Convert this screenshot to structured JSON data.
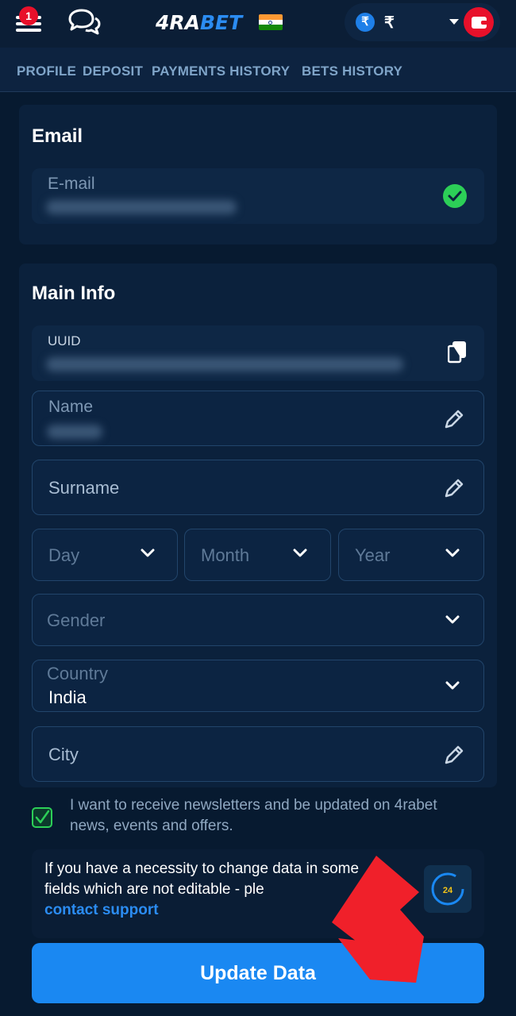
{
  "header": {
    "notifications_count": "1",
    "logo_part1": "4RA",
    "logo_part2": "BET",
    "currency_symbol": "₹",
    "balance_currency": "₹",
    "flag_colors": [
      "#ff9933",
      "#ffffff",
      "#138808"
    ]
  },
  "nav_tabs": [
    "PROFILE",
    "DEPOSIT",
    "PAYMENTS HISTORY",
    "BETS HISTORY"
  ],
  "email_section": {
    "title": "Email",
    "email_label": "E-mail",
    "verified_icon": "check-circle-icon"
  },
  "main_info": {
    "title": "Main Info",
    "uuid_label": "UUID",
    "name_label": "Name",
    "surname_placeholder": "Surname",
    "day_placeholder": "Day",
    "month_placeholder": "Month",
    "year_placeholder": "Year",
    "gender_placeholder": "Gender",
    "country_label": "Country",
    "country_value": "India",
    "city_placeholder": "City"
  },
  "newsletter": {
    "text": "I want to receive newsletters and be updated on 4rabet news, events and offers.",
    "checked": true
  },
  "support_info": {
    "text": "If you have a necessity to change data in some fields which are not editable - ple",
    "link": "contact support",
    "badge": "24"
  },
  "update_button": "Update Data",
  "colors": {
    "accent": "#1a88f2",
    "danger": "#e8102a",
    "success": "#2ccf57",
    "background": "#071a30"
  }
}
